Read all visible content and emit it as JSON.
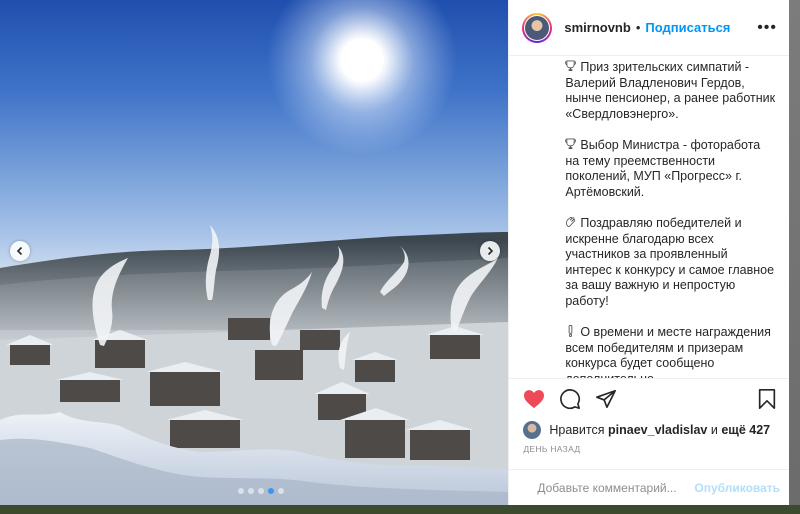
{
  "post": {
    "username": "smirnovnb",
    "separator": "•",
    "follow_label": "Подписаться",
    "more_label": "•••",
    "caption_paragraphs": [
      {
        "icon": "trophy-icon",
        "text": "Приз зрительских симпатий - Валерий Владленович Гердов, нынче пенсионер, а ранее работник «Свердловэнерго»."
      },
      {
        "icon": "trophy-icon",
        "text": "Выбор Министра - фоторабота на тему преемственности поколений, МУП «Прогресс» г. Артёмовский."
      },
      {
        "icon": "clapping-hands-icon",
        "text": "Поздравляю победителей и искренне благодарю всех участников за проявленный интерес к конкурсу и самое главное за вашу важную и непростую работу!"
      },
      {
        "icon": "exclamation-icon",
        "text": "О времени и месте награждения всем победителям и призерам конкурса будет сообщено дополнительно."
      }
    ],
    "likes": {
      "prefix": "Нравится",
      "user": "pinaev_vladislav",
      "middle": "и",
      "count_text": "ещё 427"
    },
    "time_ago": "ДЕНЬ НАЗАД",
    "comment": {
      "placeholder": "Добавьте комментарий...",
      "post_label": "Опубликовать"
    },
    "carousel": {
      "total_slides": 5,
      "active_slide": 4
    },
    "colors": {
      "like_red": "#ed4956",
      "link_blue": "#0095f6",
      "active_dot": "#3897f0"
    }
  }
}
